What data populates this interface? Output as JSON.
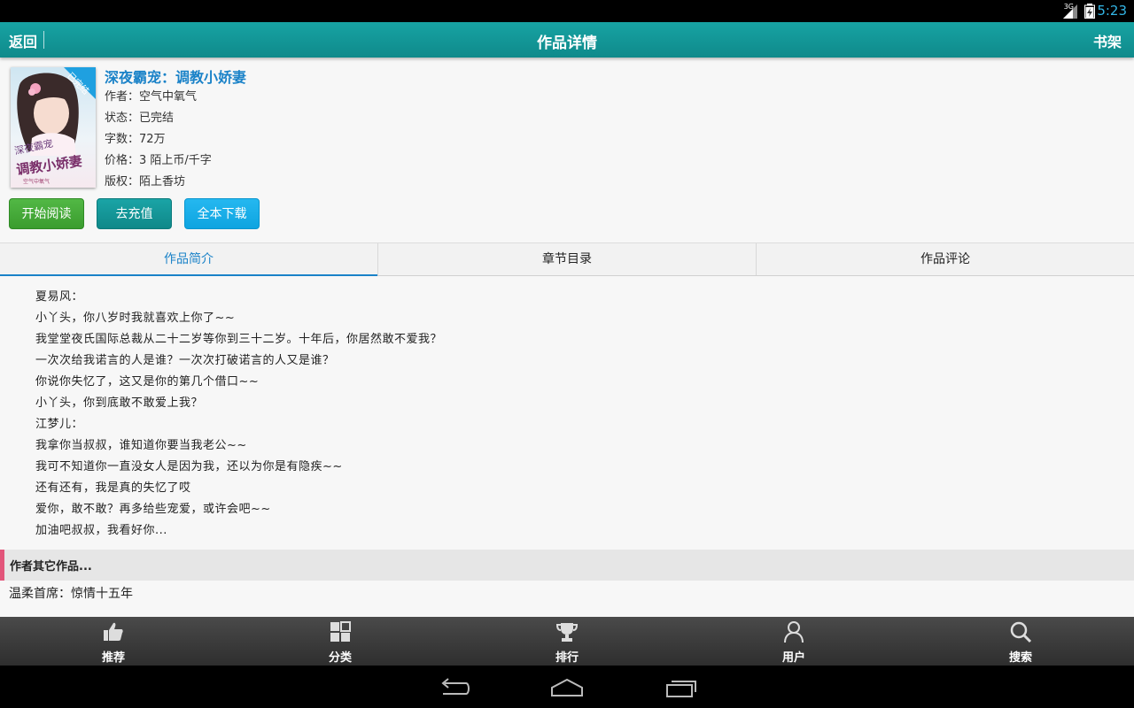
{
  "status_bar": {
    "network": "3G",
    "time": "5:23"
  },
  "title_bar": {
    "back_label": "返回",
    "title": "作品详情",
    "bookshelf_label": "书架"
  },
  "book": {
    "cover_badge": "已完结",
    "cover_title_line1": "深夜霸宠",
    "cover_title_line2": "调教小娇妻",
    "cover_author": "空气中氧气",
    "title": "深夜霸宠：调教小娇妻",
    "author_line": "作者：空气中氧气",
    "status_line": "状态：已完结",
    "words_line": "字数：72万",
    "price_line": "价格：3 陌上币/千字",
    "copyright_line": "版权：陌上香坊"
  },
  "actions": {
    "read": "开始阅读",
    "recharge": "去充值",
    "download": "全本下载"
  },
  "tabs": [
    {
      "label": "作品简介",
      "active": true
    },
    {
      "label": "章节目录",
      "active": false
    },
    {
      "label": "作品评论",
      "active": false
    }
  ],
  "intro": [
    "夏易风：",
    "小丫头，你八岁时我就喜欢上你了~~",
    "我堂堂夜氏国际总裁从二十二岁等你到三十二岁。十年后，你居然敢不爱我？",
    "一次次给我诺言的人是谁？一次次打破诺言的人又是谁？",
    "你说你失忆了，这又是你的第几个借口~~",
    "小丫头，你到底敢不敢爱上我？",
    "江梦儿：",
    "我拿你当叔叔，谁知道你要当我老公~~",
    "我可不知道你一直没女人是因为我，还以为你是有隐疾~~",
    "还有还有，我是真的失忆了哎",
    "爱你，敢不敢？再多给些宠爱，或许会吧~~",
    "加油吧叔叔，我看好你..."
  ],
  "other_works": {
    "header": "作者其它作品...",
    "items": [
      {
        "title": "温柔首席：惊情十五年"
      }
    ]
  },
  "bottom_nav": [
    {
      "label": "推荐",
      "icon": "thumbs-up-icon"
    },
    {
      "label": "分类",
      "icon": "grid-icon"
    },
    {
      "label": "排行",
      "icon": "trophy-icon"
    },
    {
      "label": "用户",
      "icon": "user-icon"
    },
    {
      "label": "搜索",
      "icon": "search-icon"
    }
  ],
  "colors": {
    "accent": "#109293",
    "link": "#1a82c8",
    "read_button": "#45aa38",
    "download_button": "#15adea",
    "section_marker": "#e2557a"
  }
}
